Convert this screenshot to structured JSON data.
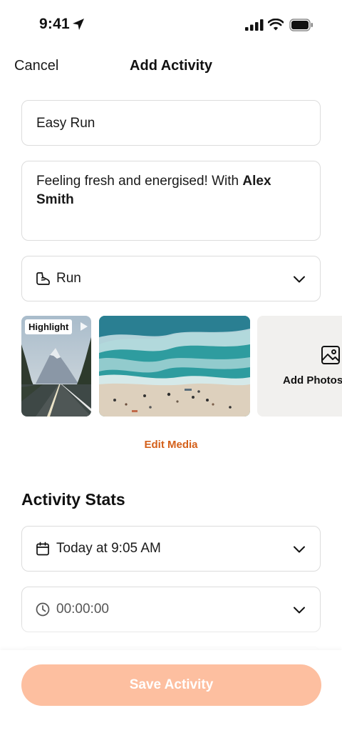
{
  "status_bar": {
    "time": "9:41"
  },
  "nav": {
    "cancel_label": "Cancel",
    "title": "Add Activity"
  },
  "form": {
    "title_value": "Easy Run",
    "description_prefix": "Feeling fresh and energised! With ",
    "description_mention": "Alex Smith",
    "sport_type": "Run",
    "sport_icon": "shoe-icon"
  },
  "media": {
    "highlight_label": "Highlight",
    "add_photos_label": "Add Photos",
    "edit_media_label": "Edit Media"
  },
  "stats": {
    "section_title": "Activity Stats",
    "date_value": "Today at 9:05 AM",
    "duration_value": "00:00:00"
  },
  "footer": {
    "save_label": "Save Activity"
  },
  "colors": {
    "accent": "#d4601a",
    "save_button_disabled": "#fdbfa0",
    "field_border": "#dcdcdc",
    "add_photos_bg": "#f1f0ee"
  }
}
